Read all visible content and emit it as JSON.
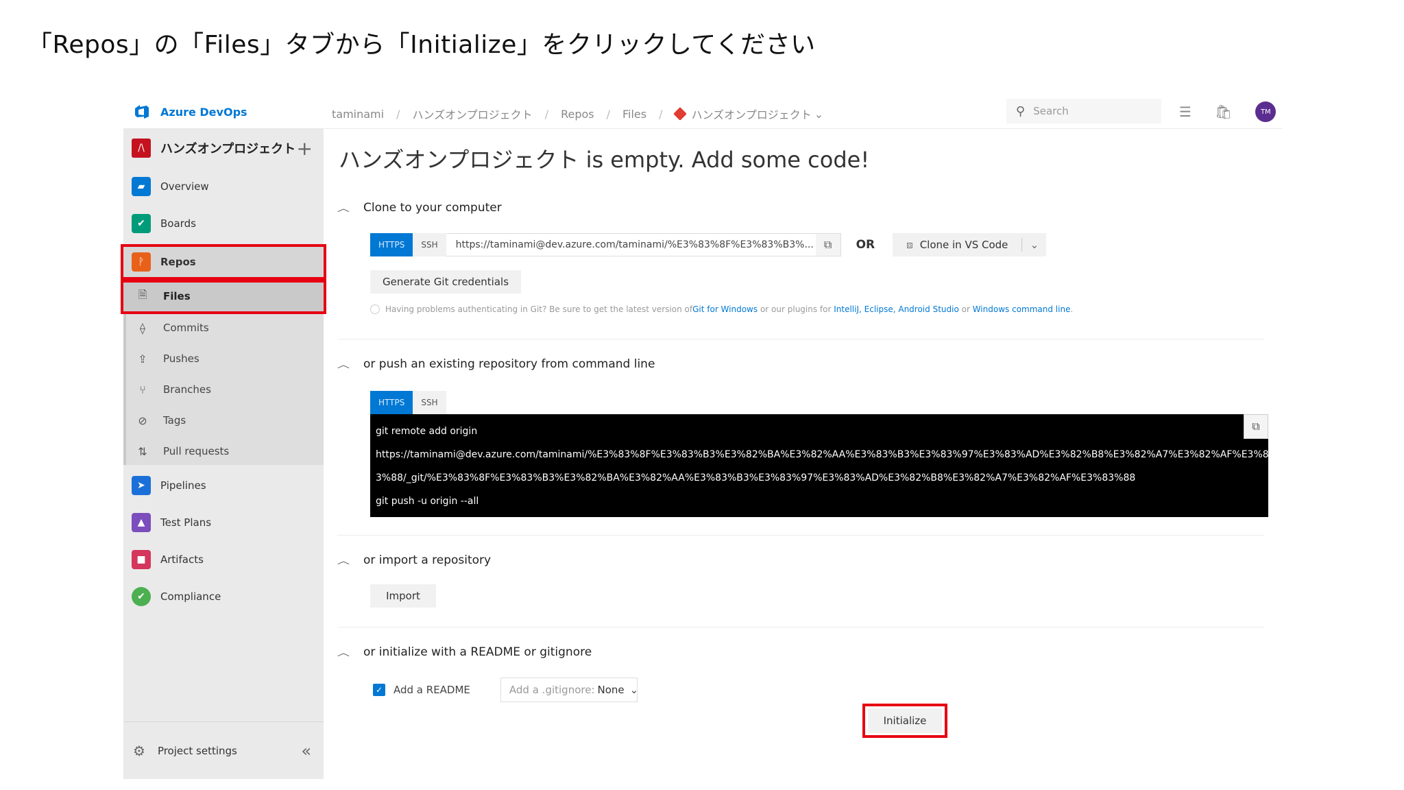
{
  "instruction": "「Repos」の「Files」タブから「Initialize」をクリックしてください",
  "brand": {
    "name": "Azure DevOps"
  },
  "breadcrumb": [
    "taminami",
    "ハンズオンプロジェクト",
    "Repos",
    "Files",
    "ハンズオンプロジェクト"
  ],
  "breadcrumb_repo_chevron": "⌄",
  "search": {
    "placeholder": "Search"
  },
  "user": {
    "initials": "TM"
  },
  "sidebar": {
    "project_icon_letter": "/\\",
    "project_name": "ハンズオンプロジェクト",
    "add_symbol": "+",
    "items": [
      {
        "label": "Overview",
        "color": "#0078d4"
      },
      {
        "label": "Boards",
        "color": "#009c7a"
      },
      {
        "label": "Repos",
        "color": "#e8611a"
      }
    ],
    "repos_subitems": [
      "Files",
      "Commits",
      "Pushes",
      "Branches",
      "Tags",
      "Pull requests"
    ],
    "lower_items": [
      {
        "label": "Pipelines",
        "color": "#1b6fd8"
      },
      {
        "label": "Test Plans",
        "color": "#7c4dbd"
      },
      {
        "label": "Artifacts",
        "color": "#d4365c"
      },
      {
        "label": "Compliance",
        "color": "#4caf50"
      }
    ],
    "footer": {
      "label": "Project settings",
      "collapse": "«"
    }
  },
  "main": {
    "title": "ハンズオンプロジェクト is empty. Add some code!",
    "clone": {
      "heading": "Clone to your computer",
      "tabs": [
        "HTTPS",
        "SSH"
      ],
      "url": "https://taminami@dev.azure.com/taminami/%E3%83%8F%E3%83%B3%...",
      "or": "OR",
      "vscode_label": "Clone in VS Code",
      "generate_label": "Generate Git credentials",
      "help_prefix": "Having problems authenticating in Git? Be sure to get the latest version of ",
      "help_link1": "Git for Windows",
      "help_mid": " or our plugins for ",
      "help_link2": "IntelliJ, Eclipse, Android Studio",
      "help_or": " or ",
      "help_link3": "Windows command line",
      "help_end": "."
    },
    "push": {
      "heading": "or push an existing repository from command line",
      "tabs": [
        "HTTPS",
        "SSH"
      ],
      "lines": [
        "git remote add origin",
        "https://taminami@dev.azure.com/taminami/%E3%83%8F%E3%83%B3%E3%82%BA%E3%82%AA%E3%83%B3%E3%83%97%E3%83%AD%E3%82%B8%E3%82%A7%E3%82%AF%E3%8",
        "3%88/_git/%E3%83%8F%E3%83%B3%E3%82%BA%E3%82%AA%E3%83%B3%E3%83%97%E3%83%AD%E3%82%B8%E3%82%A7%E3%82%AF%E3%83%88",
        "git push -u origin --all"
      ]
    },
    "import": {
      "heading": "or import a repository",
      "button": "Import"
    },
    "initialize": {
      "heading": "or initialize with a README or gitignore",
      "readme_label": "Add a README",
      "readme_checked": true,
      "gitignore_prefix": "Add a .gitignore:",
      "gitignore_value": "None",
      "button": "Initialize"
    }
  },
  "colors": {
    "accent": "#0078d4",
    "highlight": "#e60012"
  }
}
